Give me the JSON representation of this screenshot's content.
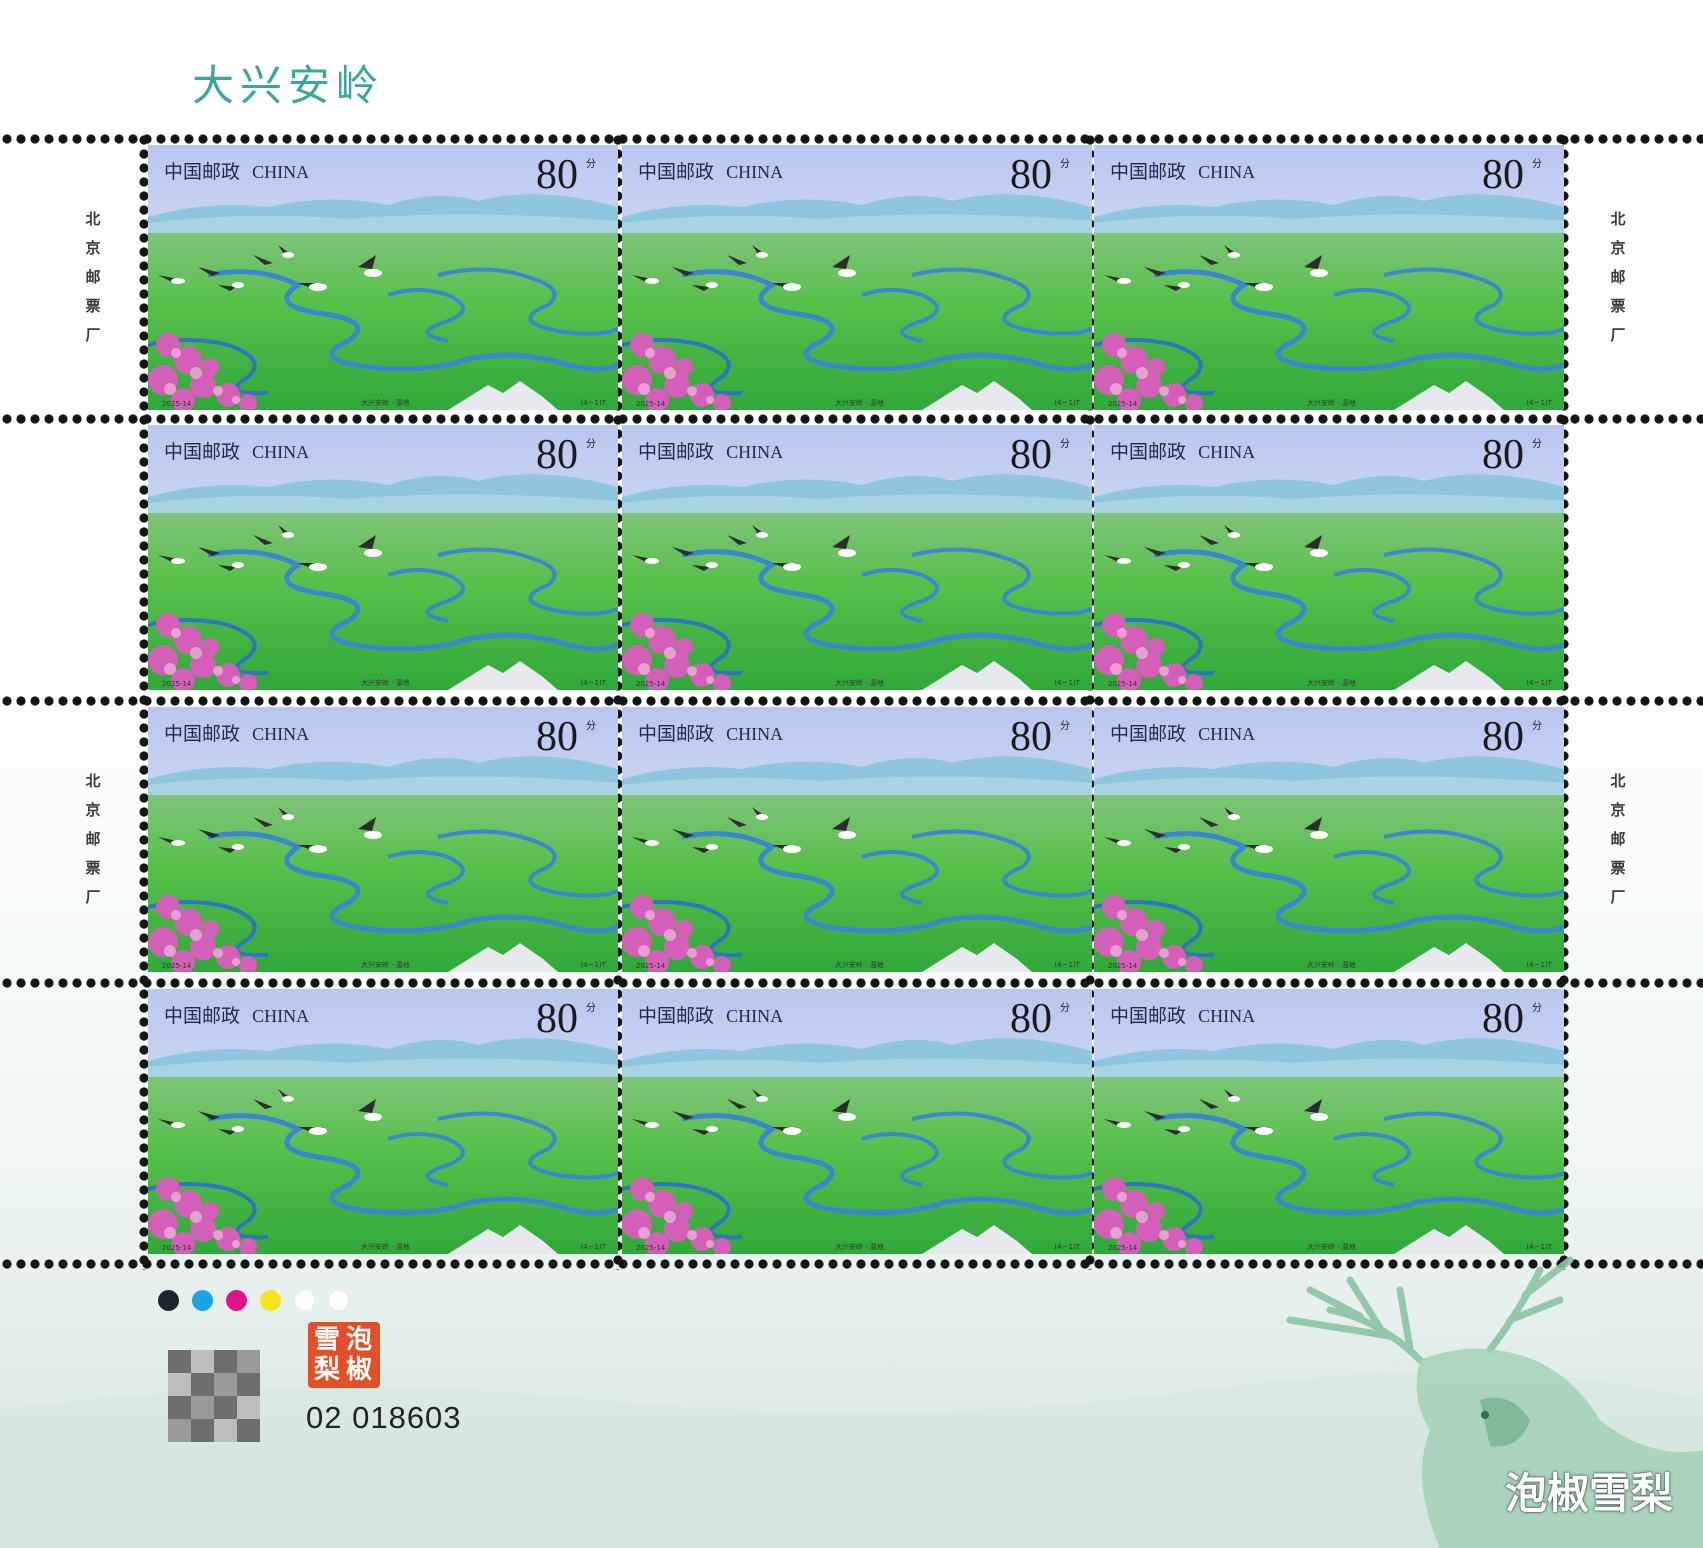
{
  "sheet": {
    "title": "大兴安岭",
    "printer_mark": "北\n京\n邮\n票\n厂",
    "serial_number": "02 018603",
    "seal_text": "泡椒雪梨",
    "watermark": "泡椒雪梨",
    "color_dots": [
      "#1d2530",
      "#19a6e8",
      "#e0148c",
      "#f3e51c",
      "#ffffff",
      "#ffffff"
    ]
  },
  "stamp": {
    "postal_name": "中国邮政",
    "country": "CHINA",
    "value": "80",
    "unit": "分",
    "code": "2025-14",
    "caption": "大兴安岭 · 湿地",
    "serial": "(4－1)T"
  },
  "icons": [
    "crane-icon",
    "moose-illustration",
    "qr-code-icon"
  ]
}
